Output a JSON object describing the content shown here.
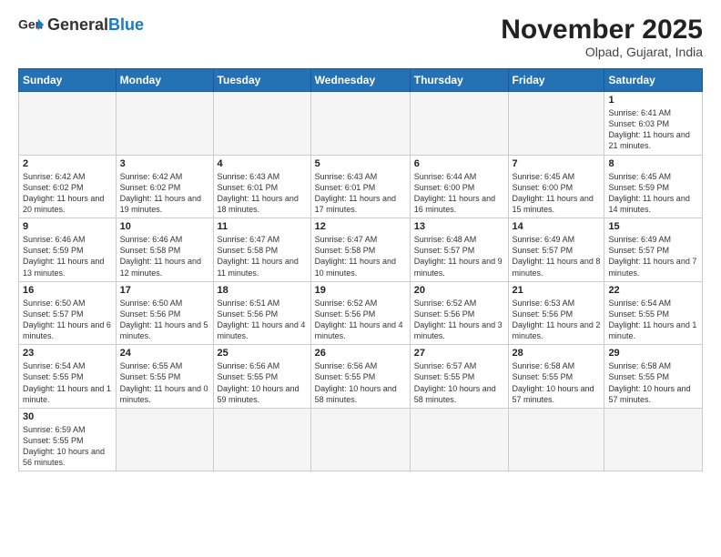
{
  "logo": {
    "text_general": "General",
    "text_blue": "Blue"
  },
  "header": {
    "month_year": "November 2025",
    "location": "Olpad, Gujarat, India"
  },
  "weekdays": [
    "Sunday",
    "Monday",
    "Tuesday",
    "Wednesday",
    "Thursday",
    "Friday",
    "Saturday"
  ],
  "days": [
    {
      "date": "",
      "info": "",
      "empty": true
    },
    {
      "date": "",
      "info": "",
      "empty": true
    },
    {
      "date": "",
      "info": "",
      "empty": true
    },
    {
      "date": "",
      "info": "",
      "empty": true
    },
    {
      "date": "",
      "info": "",
      "empty": true
    },
    {
      "date": "",
      "info": "",
      "empty": true
    },
    {
      "date": "1",
      "info": "Sunrise: 6:41 AM\nSunset: 6:03 PM\nDaylight: 11 hours and 21 minutes."
    },
    {
      "date": "2",
      "info": "Sunrise: 6:42 AM\nSunset: 6:02 PM\nDaylight: 11 hours and 20 minutes."
    },
    {
      "date": "3",
      "info": "Sunrise: 6:42 AM\nSunset: 6:02 PM\nDaylight: 11 hours and 19 minutes."
    },
    {
      "date": "4",
      "info": "Sunrise: 6:43 AM\nSunset: 6:01 PM\nDaylight: 11 hours and 18 minutes."
    },
    {
      "date": "5",
      "info": "Sunrise: 6:43 AM\nSunset: 6:01 PM\nDaylight: 11 hours and 17 minutes."
    },
    {
      "date": "6",
      "info": "Sunrise: 6:44 AM\nSunset: 6:00 PM\nDaylight: 11 hours and 16 minutes."
    },
    {
      "date": "7",
      "info": "Sunrise: 6:45 AM\nSunset: 6:00 PM\nDaylight: 11 hours and 15 minutes."
    },
    {
      "date": "8",
      "info": "Sunrise: 6:45 AM\nSunset: 5:59 PM\nDaylight: 11 hours and 14 minutes."
    },
    {
      "date": "9",
      "info": "Sunrise: 6:46 AM\nSunset: 5:59 PM\nDaylight: 11 hours and 13 minutes."
    },
    {
      "date": "10",
      "info": "Sunrise: 6:46 AM\nSunset: 5:58 PM\nDaylight: 11 hours and 12 minutes."
    },
    {
      "date": "11",
      "info": "Sunrise: 6:47 AM\nSunset: 5:58 PM\nDaylight: 11 hours and 11 minutes."
    },
    {
      "date": "12",
      "info": "Sunrise: 6:47 AM\nSunset: 5:58 PM\nDaylight: 11 hours and 10 minutes."
    },
    {
      "date": "13",
      "info": "Sunrise: 6:48 AM\nSunset: 5:57 PM\nDaylight: 11 hours and 9 minutes."
    },
    {
      "date": "14",
      "info": "Sunrise: 6:49 AM\nSunset: 5:57 PM\nDaylight: 11 hours and 8 minutes."
    },
    {
      "date": "15",
      "info": "Sunrise: 6:49 AM\nSunset: 5:57 PM\nDaylight: 11 hours and 7 minutes."
    },
    {
      "date": "16",
      "info": "Sunrise: 6:50 AM\nSunset: 5:57 PM\nDaylight: 11 hours and 6 minutes."
    },
    {
      "date": "17",
      "info": "Sunrise: 6:50 AM\nSunset: 5:56 PM\nDaylight: 11 hours and 5 minutes."
    },
    {
      "date": "18",
      "info": "Sunrise: 6:51 AM\nSunset: 5:56 PM\nDaylight: 11 hours and 4 minutes."
    },
    {
      "date": "19",
      "info": "Sunrise: 6:52 AM\nSunset: 5:56 PM\nDaylight: 11 hours and 4 minutes."
    },
    {
      "date": "20",
      "info": "Sunrise: 6:52 AM\nSunset: 5:56 PM\nDaylight: 11 hours and 3 minutes."
    },
    {
      "date": "21",
      "info": "Sunrise: 6:53 AM\nSunset: 5:56 PM\nDaylight: 11 hours and 2 minutes."
    },
    {
      "date": "22",
      "info": "Sunrise: 6:54 AM\nSunset: 5:55 PM\nDaylight: 11 hours and 1 minute."
    },
    {
      "date": "23",
      "info": "Sunrise: 6:54 AM\nSunset: 5:55 PM\nDaylight: 11 hours and 1 minute."
    },
    {
      "date": "24",
      "info": "Sunrise: 6:55 AM\nSunset: 5:55 PM\nDaylight: 11 hours and 0 minutes."
    },
    {
      "date": "25",
      "info": "Sunrise: 6:56 AM\nSunset: 5:55 PM\nDaylight: 10 hours and 59 minutes."
    },
    {
      "date": "26",
      "info": "Sunrise: 6:56 AM\nSunset: 5:55 PM\nDaylight: 10 hours and 58 minutes."
    },
    {
      "date": "27",
      "info": "Sunrise: 6:57 AM\nSunset: 5:55 PM\nDaylight: 10 hours and 58 minutes."
    },
    {
      "date": "28",
      "info": "Sunrise: 6:58 AM\nSunset: 5:55 PM\nDaylight: 10 hours and 57 minutes."
    },
    {
      "date": "29",
      "info": "Sunrise: 6:58 AM\nSunset: 5:55 PM\nDaylight: 10 hours and 57 minutes."
    },
    {
      "date": "30",
      "info": "Sunrise: 6:59 AM\nSunset: 5:55 PM\nDaylight: 10 hours and 56 minutes."
    }
  ]
}
